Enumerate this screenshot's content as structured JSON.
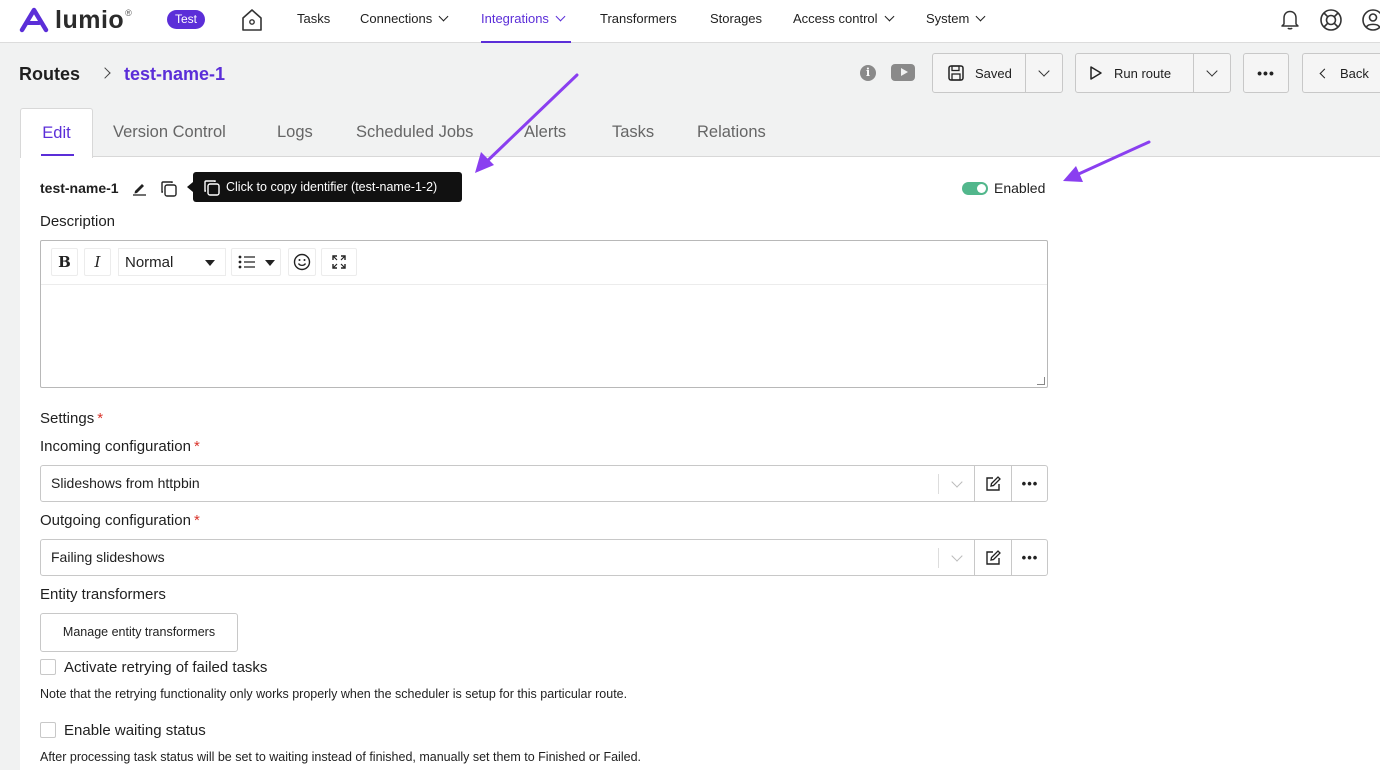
{
  "app": {
    "logo_text": "lumio",
    "logo_reg": "®",
    "environment_badge": "Test"
  },
  "topnav": {
    "items": [
      {
        "label": "Tasks",
        "dropdown": false
      },
      {
        "label": "Connections",
        "dropdown": true
      },
      {
        "label": "Integrations",
        "dropdown": true,
        "active": true
      },
      {
        "label": "Transformers",
        "dropdown": false
      },
      {
        "label": "Storages",
        "dropdown": false
      },
      {
        "label": "Access control",
        "dropdown": true
      },
      {
        "label": "System",
        "dropdown": true
      }
    ],
    "icons": [
      "home-icon",
      "bell-icon",
      "help-lifebuoy-icon",
      "user-icon"
    ]
  },
  "breadcrumb": {
    "root": "Routes",
    "current": "test-name-1"
  },
  "toolbar": {
    "info_icon_glyph": "i",
    "saved_label": "Saved",
    "run_route_label": "Run route",
    "more_glyph": "•••",
    "back_label": "Back"
  },
  "tabs": [
    {
      "label": "Edit",
      "active": true
    },
    {
      "label": "Version Control"
    },
    {
      "label": "Logs"
    },
    {
      "label": "Scheduled Jobs"
    },
    {
      "label": "Alerts"
    },
    {
      "label": "Tasks"
    },
    {
      "label": "Relations"
    }
  ],
  "route": {
    "name": "test-name-1",
    "copy_tooltip": "Click to copy identifier (test-name-1-2)",
    "enabled": true,
    "enabled_label": "Enabled"
  },
  "form": {
    "description_label": "Description",
    "editor": {
      "bold_glyph": "B",
      "italic_glyph": "I",
      "format_value": "Normal",
      "body_text": ""
    },
    "settings_label": "Settings",
    "required_mark": "*",
    "incoming_label": "Incoming configuration",
    "incoming_value": "Slideshows from httpbin",
    "outgoing_label": "Outgoing configuration",
    "outgoing_value": "Failing slideshows",
    "entity_transformers_label": "Entity transformers",
    "manage_transformers_label": "Manage entity transformers",
    "retry_checkbox_label": "Activate retrying of failed tasks",
    "retry_checked": false,
    "retry_note": "Note that the retrying functionality only works properly when the scheduler is setup for this particular route.",
    "waiting_checkbox_label": "Enable waiting status",
    "waiting_checked": false,
    "waiting_note": "After processing task status will be set to waiting instead of finished, manually set them to Finished or Failed."
  },
  "colors": {
    "accent": "#5b2ed8",
    "toggle_on": "#52b78c",
    "required": "#d9342b",
    "annotation_arrow": "#8a3ff0"
  }
}
